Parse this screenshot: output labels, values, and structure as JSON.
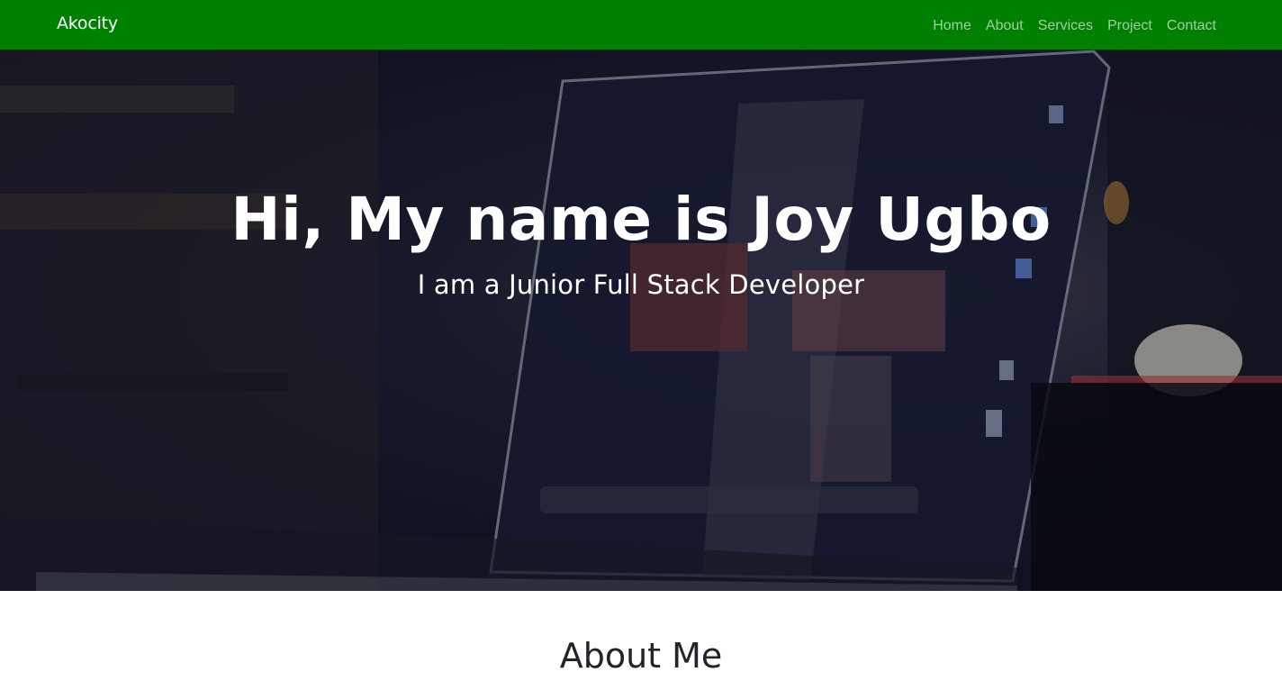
{
  "navbar": {
    "brand": "Akocity",
    "links": [
      "Home",
      "About",
      "Services",
      "Project",
      "Contact"
    ],
    "background": "#008000"
  },
  "hero": {
    "title": "Hi, My name is Joy Ugbo",
    "subtitle": "I am a Junior Full Stack Developer"
  },
  "about": {
    "title": "About Me"
  }
}
